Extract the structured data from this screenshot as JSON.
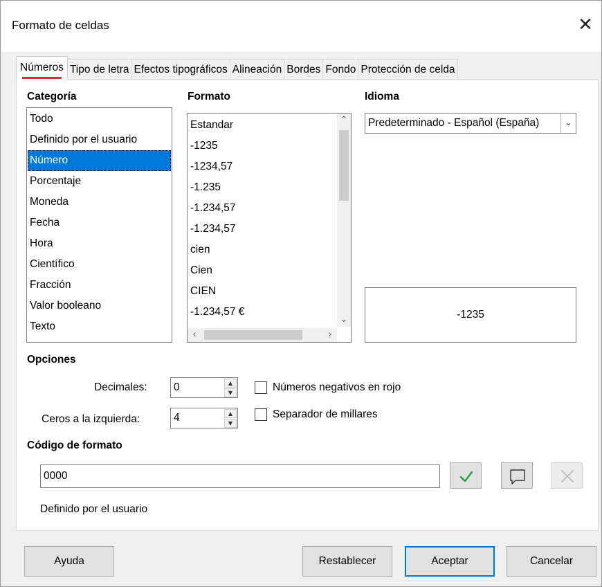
{
  "window": {
    "title": "Formato de celdas",
    "close_glyph": "✕"
  },
  "tabs": [
    {
      "label": "Números",
      "active": true
    },
    {
      "label": "Tipo de letra"
    },
    {
      "label": "Efectos tipográficos"
    },
    {
      "label": "Alineación"
    },
    {
      "label": "Bordes"
    },
    {
      "label": "Fondo"
    },
    {
      "label": "Protección de celda"
    }
  ],
  "categoria": {
    "label": "Categoría",
    "items": [
      "Todo",
      "Definido por el usuario",
      "Número",
      "Porcentaje",
      "Moneda",
      "Fecha",
      "Hora",
      "Científico",
      "Fracción",
      "Valor booleano",
      "Texto"
    ],
    "selected": "Número"
  },
  "formato": {
    "label": "Formato",
    "items": [
      "Estandar",
      "-1235",
      "-1234,57",
      "-1.235",
      "-1.234,57",
      "-1.234,57",
      "cien",
      "Cien",
      "CIEN",
      "-1.234,57 €"
    ]
  },
  "idioma": {
    "label": "Idioma",
    "value": "Predeterminado - Español (España)"
  },
  "preview": {
    "value": "-1235"
  },
  "opciones": {
    "label": "Opciones",
    "decimales_label": "Decimales:",
    "decimales_value": "0",
    "ceros_label": "Ceros a la izquierda:",
    "ceros_value": "4",
    "negativos_rojo_label": "Números negativos en rojo",
    "negativos_rojo_checked": false,
    "separador_label": "Separador de millares",
    "separador_checked": false
  },
  "codigo": {
    "label": "Código de formato",
    "value": "0000",
    "description": "Definido por el usuario"
  },
  "buttons": {
    "help": "Ayuda",
    "reset": "Restablecer",
    "ok": "Aceptar",
    "cancel": "Cancelar"
  },
  "colors": {
    "selection": "#0078d7",
    "tab_indicator": "#d32f2f",
    "check_green": "#2e9e3e"
  }
}
